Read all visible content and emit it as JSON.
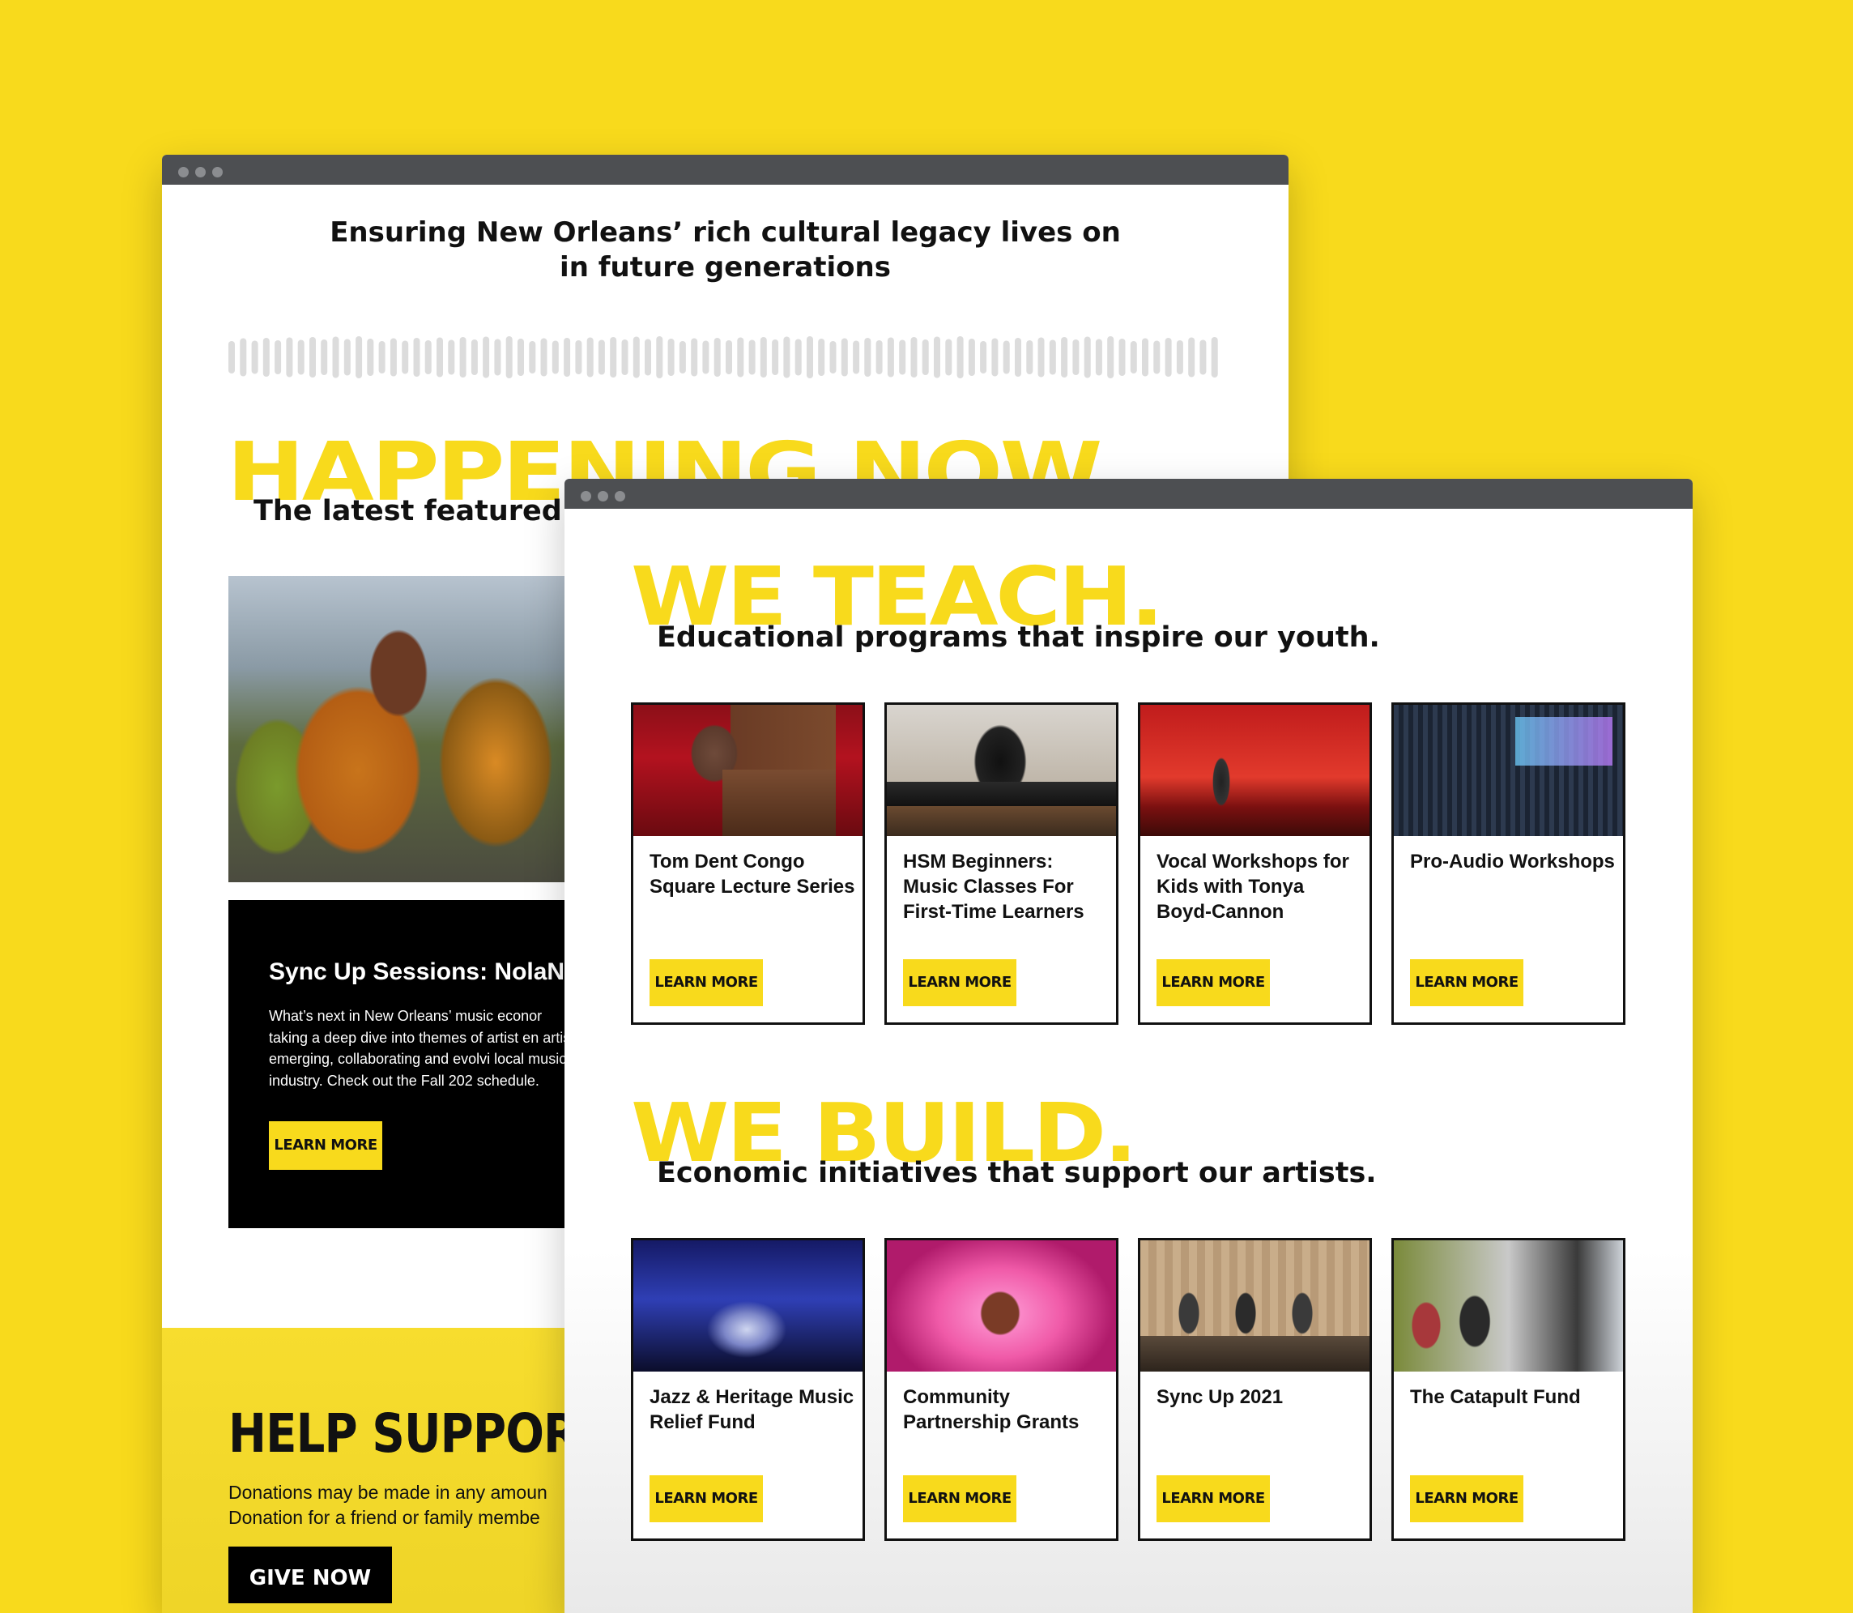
{
  "back_window": {
    "tagline_line1": "Ensuring New Orleans’ rich cultural legacy lives on",
    "tagline_line2": "in future generations",
    "happening_title": "HAPPENING NOW",
    "happening_subtitle": "The latest featured o",
    "featured": {
      "title": "Sync Up Sessions: NolaNex",
      "body": "What’s next in New Orleans’ music econor taking a deep dive into themes of artist en artists emerging, collaborating and evolvi local music industry. Check out the Fall 202 schedule.",
      "button": "LEARN MORE"
    },
    "support": {
      "title": "HELP SUPPORT O",
      "body_line1": "Donations may be made in any amoun",
      "body_line2": "Donation for a friend or family membe",
      "button": "GIVE NOW"
    }
  },
  "front_window": {
    "teach": {
      "title": "WE TEACH.",
      "subtitle": "Educational programs that inspire our youth.",
      "cards": [
        {
          "title": "Tom Dent Congo Square Lecture Series",
          "button": "LEARN MORE"
        },
        {
          "title": "HSM Beginners: Music Classes For First-Time Learners",
          "button": "LEARN MORE"
        },
        {
          "title": "Vocal Workshops for Kids with Tonya Boyd-Cannon",
          "button": "LEARN MORE"
        },
        {
          "title": "Pro-Audio Workshops",
          "button": "LEARN MORE"
        }
      ]
    },
    "build": {
      "title": "WE BUILD.",
      "subtitle": "Economic initiatives that support our artists.",
      "cards": [
        {
          "title": "Jazz & Heritage Music Relief Fund",
          "button": "LEARN MORE"
        },
        {
          "title": "Community Partnership Grants",
          "button": "LEARN MORE"
        },
        {
          "title": "Sync Up 2021",
          "button": "LEARN MORE"
        },
        {
          "title": "The Catapult Fund",
          "button": "LEARN MORE"
        }
      ]
    }
  },
  "colors": {
    "brand_yellow": "#F8DA1C",
    "titlebar": "#4D4F52",
    "text_dark": "#111111"
  }
}
